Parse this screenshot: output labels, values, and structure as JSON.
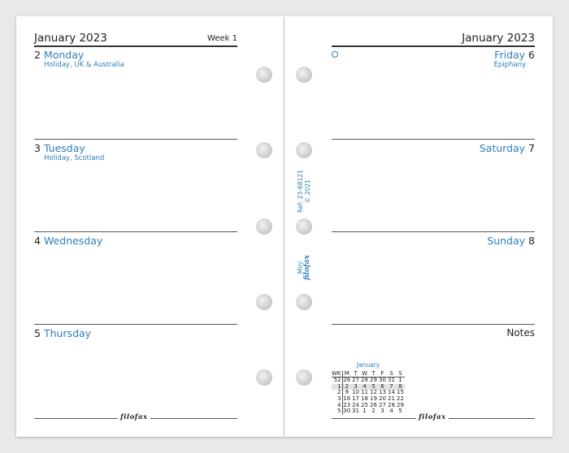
{
  "left": {
    "month_year": "January 2023",
    "week": "Week 1",
    "days": [
      {
        "num": "2",
        "name": "Monday",
        "note": "Holiday, UK & Australia"
      },
      {
        "num": "3",
        "name": "Tuesday",
        "note": "Holiday, Scotland"
      },
      {
        "num": "4",
        "name": "Wednesday",
        "note": ""
      },
      {
        "num": "5",
        "name": "Thursday",
        "note": ""
      }
    ]
  },
  "right": {
    "month_year": "January 2023",
    "days": [
      {
        "num": "6",
        "name": "Friday",
        "note": "Epiphany"
      },
      {
        "num": "7",
        "name": "Saturday",
        "note": ""
      },
      {
        "num": "8",
        "name": "Sunday",
        "note": ""
      }
    ],
    "notes_label": "Notes"
  },
  "spine": {
    "ref": "Ref: 23-68121",
    "copyright": "© 2021",
    "size": "Mini",
    "brand": "filofax"
  },
  "footer_brand": "filofax",
  "mini_calendar": {
    "month": "January",
    "headers": [
      "WK",
      "M",
      "T",
      "W",
      "T",
      "F",
      "S",
      "S"
    ],
    "rows": [
      [
        "52",
        "26",
        "27",
        "28",
        "29",
        "30",
        "31",
        "1"
      ],
      [
        "1",
        "2",
        "3",
        "4",
        "5",
        "6",
        "7",
        "8"
      ],
      [
        "2",
        "9",
        "10",
        "11",
        "12",
        "13",
        "14",
        "15"
      ],
      [
        "3",
        "16",
        "17",
        "18",
        "19",
        "20",
        "21",
        "22"
      ],
      [
        "4",
        "23",
        "24",
        "25",
        "26",
        "27",
        "28",
        "29"
      ],
      [
        "5",
        "30",
        "31",
        "1",
        "2",
        "3",
        "4",
        "5"
      ]
    ],
    "current_week": "1"
  },
  "colors": {
    "accent": "#2f7fb8"
  }
}
